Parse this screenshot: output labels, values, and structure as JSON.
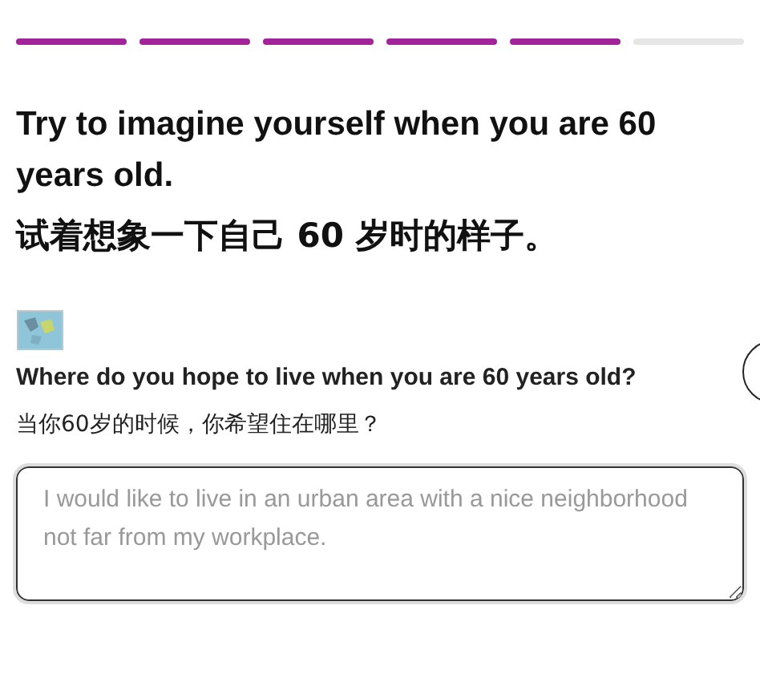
{
  "progress": [
    {
      "done": true
    },
    {
      "done": true
    },
    {
      "done": true
    },
    {
      "done": true
    },
    {
      "done": true
    },
    {
      "done": false
    }
  ],
  "title": "Try to imagine yourself when you are 60 years old.",
  "title_zh": "试着想象一下自己 60 岁时的样子。",
  "question": "Where do you hope to live when you are 60 years old?",
  "question_zh": "当你60岁的时候，你希望住在哪里？",
  "answer": {
    "placeholder": "I would like to live in an urban area with a nice neighborhood not far from my workplace."
  }
}
